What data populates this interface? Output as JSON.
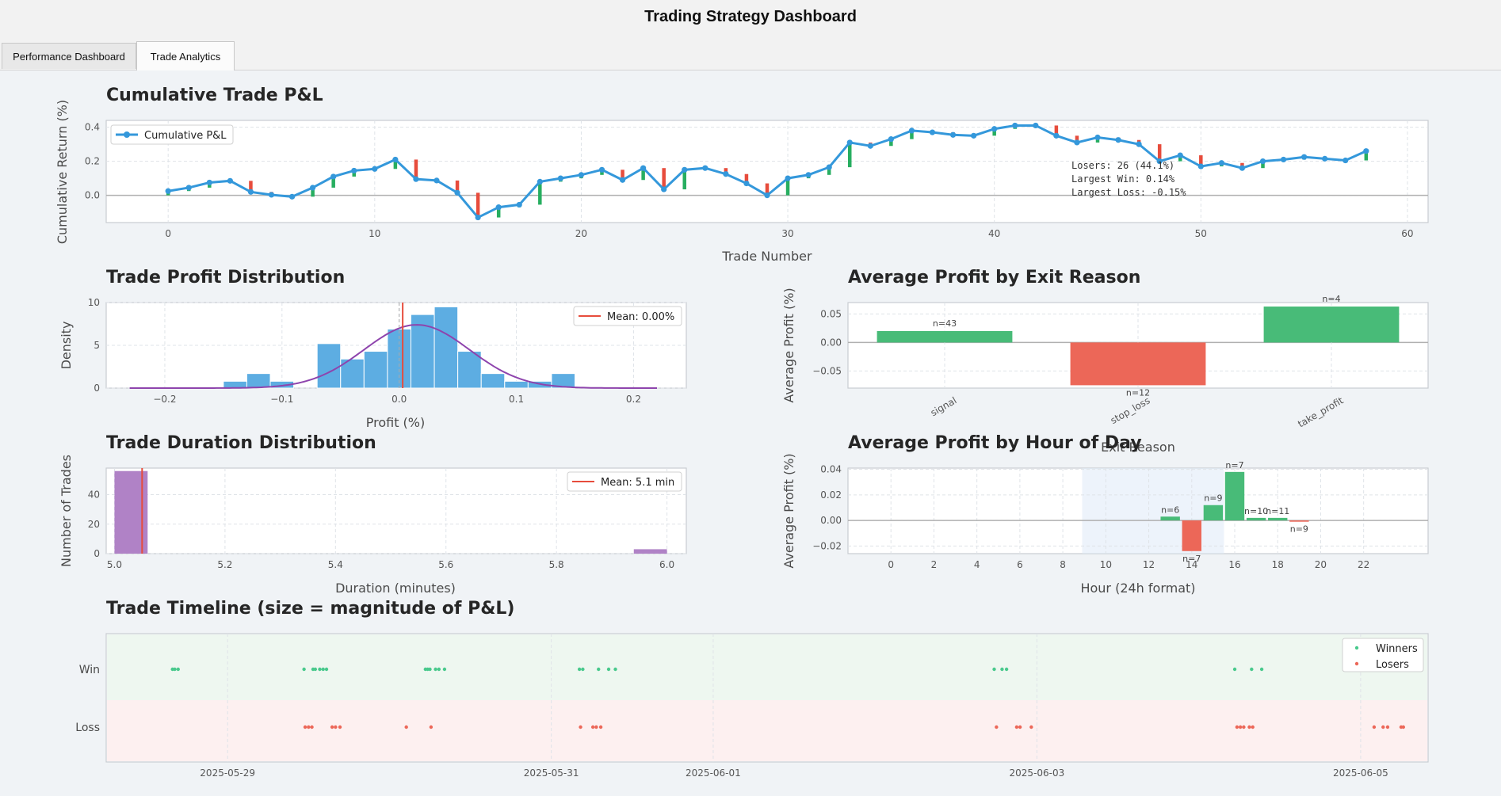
{
  "window": {
    "title": "Trading Strategy Dashboard"
  },
  "tabs": [
    {
      "label": "Performance Dashboard",
      "active": false
    },
    {
      "label": "Trade Analytics",
      "active": true
    }
  ],
  "chart_data": [
    {
      "id": "cumulative",
      "type": "line",
      "title": "Cumulative Trade P&L",
      "xlabel": "Trade Number",
      "ylabel": "Cumulative Return (%)",
      "xlim": [
        -3,
        61
      ],
      "ylim": [
        -0.16,
        0.44
      ],
      "xticks": [
        0,
        10,
        20,
        30,
        40,
        50,
        60
      ],
      "yticks": [
        0.0,
        0.2,
        0.4
      ],
      "legend": "Cumulative P&L",
      "series": [
        {
          "name": "Cumulative P&L",
          "color": "#3498db",
          "x": [
            0,
            1,
            2,
            3,
            4,
            5,
            6,
            7,
            8,
            9,
            10,
            11,
            12,
            13,
            14,
            15,
            16,
            17,
            18,
            19,
            20,
            21,
            22,
            23,
            24,
            25,
            26,
            27,
            28,
            29,
            30,
            31,
            32,
            33,
            34,
            35,
            36,
            37,
            38,
            39,
            40,
            41,
            42,
            43,
            44,
            45,
            46,
            47,
            48,
            49,
            50,
            51,
            52,
            53,
            54,
            55,
            56,
            57,
            58
          ],
          "y": [
            0.025,
            0.045,
            0.075,
            0.085,
            0.02,
            0.003,
            -0.008,
            0.045,
            0.11,
            0.145,
            0.155,
            0.21,
            0.095,
            0.087,
            0.015,
            -0.13,
            -0.07,
            -0.055,
            0.08,
            0.1,
            0.12,
            0.15,
            0.09,
            0.16,
            0.035,
            0.15,
            0.16,
            0.125,
            0.07,
            0.0,
            0.1,
            0.12,
            0.165,
            0.31,
            0.29,
            0.33,
            0.38,
            0.37,
            0.355,
            0.35,
            0.39,
            0.41,
            0.41,
            0.35,
            0.31,
            0.34,
            0.325,
            0.3,
            0.2,
            0.235,
            0.17,
            0.19,
            0.16,
            0.2,
            0.21,
            0.225,
            0.215,
            0.205,
            0.26
          ]
        }
      ],
      "trade_bars": [
        {
          "from": 0.0,
          "to": 0.025
        },
        {
          "from": 0.025,
          "to": 0.045
        },
        {
          "from": 0.045,
          "to": 0.075
        },
        {
          "from": 0.075,
          "to": 0.085
        },
        {
          "from": 0.085,
          "to": 0.02
        },
        {
          "from": 0.02,
          "to": 0.003
        },
        {
          "from": 0.003,
          "to": -0.008
        },
        {
          "from": -0.008,
          "to": 0.045
        },
        {
          "from": 0.045,
          "to": 0.11
        },
        {
          "from": 0.11,
          "to": 0.145
        },
        {
          "from": 0.145,
          "to": 0.155
        },
        {
          "from": 0.155,
          "to": 0.21
        },
        {
          "from": 0.21,
          "to": 0.095
        },
        {
          "from": 0.095,
          "to": 0.087
        },
        {
          "from": 0.087,
          "to": 0.015
        },
        {
          "from": 0.015,
          "to": -0.13
        },
        {
          "from": -0.13,
          "to": -0.07
        },
        {
          "from": -0.07,
          "to": -0.055
        },
        {
          "from": -0.055,
          "to": 0.08
        },
        {
          "from": 0.08,
          "to": 0.1
        },
        {
          "from": 0.1,
          "to": 0.12
        },
        {
          "from": 0.12,
          "to": 0.15
        },
        {
          "from": 0.15,
          "to": 0.09
        },
        {
          "from": 0.09,
          "to": 0.16
        },
        {
          "from": 0.16,
          "to": 0.035
        },
        {
          "from": 0.035,
          "to": 0.15
        },
        {
          "from": 0.15,
          "to": 0.16
        },
        {
          "from": 0.16,
          "to": 0.125
        },
        {
          "from": 0.125,
          "to": 0.07
        },
        {
          "from": 0.07,
          "to": 0.0
        },
        {
          "from": 0.0,
          "to": 0.1
        },
        {
          "from": 0.1,
          "to": 0.12
        },
        {
          "from": 0.12,
          "to": 0.165
        },
        {
          "from": 0.165,
          "to": 0.31
        },
        {
          "from": 0.31,
          "to": 0.29
        },
        {
          "from": 0.29,
          "to": 0.33
        },
        {
          "from": 0.33,
          "to": 0.38
        },
        {
          "from": 0.38,
          "to": 0.37
        },
        {
          "from": 0.37,
          "to": 0.355
        },
        {
          "from": 0.355,
          "to": 0.35
        },
        {
          "from": 0.35,
          "to": 0.39
        },
        {
          "from": 0.39,
          "to": 0.41
        },
        {
          "from": 0.41,
          "to": 0.41
        },
        {
          "from": 0.41,
          "to": 0.35
        },
        {
          "from": 0.35,
          "to": 0.31
        },
        {
          "from": 0.31,
          "to": 0.34
        },
        {
          "from": 0.34,
          "to": 0.325
        },
        {
          "from": 0.325,
          "to": 0.3
        },
        {
          "from": 0.3,
          "to": 0.2
        },
        {
          "from": 0.2,
          "to": 0.235
        },
        {
          "from": 0.235,
          "to": 0.17
        },
        {
          "from": 0.17,
          "to": 0.19
        },
        {
          "from": 0.19,
          "to": 0.16
        },
        {
          "from": 0.16,
          "to": 0.2
        },
        {
          "from": 0.2,
          "to": 0.21
        },
        {
          "from": 0.21,
          "to": 0.225
        },
        {
          "from": 0.225,
          "to": 0.215
        },
        {
          "from": 0.215,
          "to": 0.205
        },
        {
          "from": 0.205,
          "to": 0.26
        }
      ],
      "colors": {
        "win": "#27ae60",
        "loss": "#e74c3c"
      },
      "stats_text": [
        "Losers: 26 (44.1%)",
        "Largest Win: 0.14%",
        "Largest Loss: -0.15%"
      ]
    },
    {
      "id": "profit_dist",
      "type": "bar",
      "title": "Trade Profit Distribution",
      "xlabel": "Profit (%)",
      "ylabel": "Density",
      "xlim": [
        -0.25,
        0.245
      ],
      "ylim": [
        0,
        10
      ],
      "xticks": [
        -0.2,
        -0.1,
        0.0,
        0.1,
        0.2
      ],
      "yticks": [
        0,
        5,
        10
      ],
      "bin_edges": [
        -0.15,
        -0.13,
        -0.11,
        -0.09,
        -0.07,
        -0.05,
        -0.03,
        -0.01,
        0.01,
        0.03,
        0.05,
        0.07,
        0.09,
        0.11,
        0.13,
        0.15
      ],
      "values": [
        0.8,
        1.7,
        0.8,
        0,
        5.2,
        3.4,
        4.3,
        6.9,
        8.6,
        9.5,
        4.3,
        1.7,
        0.8,
        0.8,
        1.7
      ],
      "bar_color": "#5dade2",
      "kde_color": "#8e44ad",
      "kde": {
        "mean": 0.015,
        "sd": 0.045,
        "peak": 7.4,
        "xmin": -0.23,
        "xmax": 0.22
      },
      "mean_line": {
        "value": 0.003,
        "label": "Mean: 0.00%",
        "color": "#e74c3c"
      },
      "zero_line": 0.0
    },
    {
      "id": "exit_reason",
      "type": "bar",
      "title": "Average Profit by Exit Reason",
      "xlabel": "Exit Reason",
      "ylabel": "Average Profit (%)",
      "ylim": [
        -0.08,
        0.07
      ],
      "yticks": [
        0.05,
        0.0,
        -0.05
      ],
      "categories": [
        "signal",
        "stop_loss",
        "take_profit"
      ],
      "values": [
        0.02,
        -0.075,
        0.063
      ],
      "counts": [
        "n=43",
        "n=12",
        "n=4"
      ],
      "colors": {
        "pos": "#48bb78",
        "neg": "#ec6758"
      }
    },
    {
      "id": "duration",
      "type": "bar",
      "title": "Trade Duration Distribution",
      "xlabel": "Duration (minutes)",
      "ylabel": "Number of Trades",
      "xlim": [
        4.985,
        6.035
      ],
      "ylim": [
        0,
        58
      ],
      "xticks": [
        5.0,
        5.2,
        5.4,
        5.6,
        5.8,
        6.0
      ],
      "yticks": [
        0,
        20,
        40
      ],
      "bin_edges": [
        5.0,
        5.06,
        5.94,
        6.0
      ],
      "values": [
        56,
        0,
        3
      ],
      "bar_color": "#b082c6",
      "mean_line": {
        "value": 5.05,
        "label": "Mean: 5.1 min",
        "color": "#e74c3c"
      }
    },
    {
      "id": "hourly",
      "type": "bar",
      "title": "Average Profit by Hour of Day",
      "xlabel": "Hour (24h format)",
      "ylabel": "Average Profit (%)",
      "xlim": [
        -2,
        25
      ],
      "ylim": [
        -0.026,
        0.041
      ],
      "xticks": [
        0,
        2,
        4,
        6,
        8,
        10,
        12,
        14,
        16,
        18,
        20,
        22
      ],
      "yticks": [
        0.04,
        0.02,
        0.0,
        -0.02
      ],
      "shaded_hours": [
        8.9,
        15.5
      ],
      "hours": [
        13,
        14,
        15,
        16,
        17,
        18,
        19
      ],
      "values": [
        0.003,
        -0.024,
        0.012,
        0.038,
        0.002,
        0.002,
        -0.001
      ],
      "counts": [
        "n=6",
        "n=7",
        "n=9",
        "n=7",
        "n=10",
        "n=11",
        "n=9"
      ],
      "colors": {
        "pos": "#48bb78",
        "neg": "#ec6758"
      }
    },
    {
      "id": "timeline",
      "type": "scatter",
      "title": "Trade Timeline (size = magnitude of P&L)",
      "categories": [
        "Win",
        "Loss"
      ],
      "xlim": [
        "2025-05-28T06:00",
        "2025-06-05T10:00"
      ],
      "xticks": [
        "2025-05-29",
        "2025-05-31",
        "2025-06-01",
        "2025-06-03",
        "2025-06-05"
      ],
      "legend": [
        "Winners",
        "Losers"
      ],
      "colors": {
        "win": "#48c98c",
        "loss": "#ec6758",
        "win_band": "#eef7f0",
        "loss_band": "#fdf0f0"
      },
      "winners": [
        "2025-05-28T15:50",
        "2025-05-28T16:10",
        "2025-05-28T16:40",
        "2025-05-29T11:20",
        "2025-05-29T12:40",
        "2025-05-29T13:00",
        "2025-05-29T13:40",
        "2025-05-29T14:10",
        "2025-05-29T14:40",
        "2025-05-30T05:20",
        "2025-05-30T05:40",
        "2025-05-30T06:00",
        "2025-05-30T06:50",
        "2025-05-30T07:20",
        "2025-05-30T08:10",
        "2025-05-31T04:10",
        "2025-05-31T04:40",
        "2025-05-31T07:00",
        "2025-05-31T08:30",
        "2025-05-31T09:30",
        "2025-06-02T17:40",
        "2025-06-02T18:50",
        "2025-06-02T19:30",
        "2025-06-04T05:20",
        "2025-06-04T07:50",
        "2025-06-04T09:20",
        "2025-06-05T04:40"
      ],
      "losers": [
        "2025-05-29T11:30",
        "2025-05-29T12:00",
        "2025-05-29T12:30",
        "2025-05-29T15:30",
        "2025-05-29T16:00",
        "2025-05-29T16:40",
        "2025-05-30T02:30",
        "2025-05-30T06:10",
        "2025-05-31T04:20",
        "2025-05-31T06:10",
        "2025-05-31T06:40",
        "2025-05-31T07:20",
        "2025-06-02T18:00",
        "2025-06-02T21:00",
        "2025-06-02T21:30",
        "2025-06-02T23:10",
        "2025-06-04T05:40",
        "2025-06-04T06:10",
        "2025-06-04T06:40",
        "2025-06-04T07:30",
        "2025-06-04T08:00",
        "2025-06-05T02:00",
        "2025-06-05T03:20",
        "2025-06-05T04:00",
        "2025-06-05T06:00",
        "2025-06-05T06:20"
      ]
    }
  ]
}
